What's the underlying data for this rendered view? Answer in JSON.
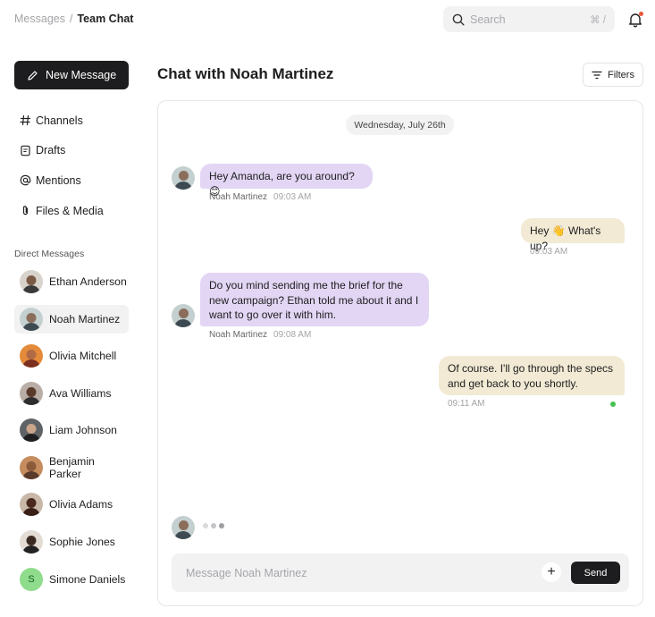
{
  "breadcrumb": {
    "parent": "Messages",
    "separator": "/",
    "current": "Team Chat"
  },
  "search": {
    "placeholder": "Search",
    "shortcut": "⌘ /",
    "icon": "search-icon"
  },
  "header": {
    "notification_icon": "bell-icon",
    "has_unread": true
  },
  "sidebar": {
    "new_message_label": "New Message",
    "nav": [
      {
        "label": "Channels",
        "icon": "hash-icon"
      },
      {
        "label": "Drafts",
        "icon": "file-icon"
      },
      {
        "label": "Mentions",
        "icon": "at-icon"
      },
      {
        "label": "Files & Media",
        "icon": "paperclip-icon"
      }
    ],
    "direct_messages_title": "Direct Messages",
    "direct_messages": [
      {
        "name": "Ethan Anderson",
        "active": false
      },
      {
        "name": "Noah Martinez",
        "active": true
      },
      {
        "name": "Olivia Mitchell",
        "active": false
      },
      {
        "name": "Ava Williams",
        "active": false
      },
      {
        "name": "Liam Johnson",
        "active": false
      },
      {
        "name": "Benjamin Parker",
        "active": false
      },
      {
        "name": "Olivia Adams",
        "active": false
      },
      {
        "name": "Sophie Jones",
        "active": false
      },
      {
        "name": "Simone Daniels",
        "active": false,
        "initial": "S"
      }
    ]
  },
  "chat": {
    "title": "Chat with Noah Martinez",
    "filters_label": "Filters",
    "date_divider": "Wednesday, July 26th",
    "messages": [
      {
        "direction": "in",
        "text": "Hey Amanda, are you around? 😊",
        "sender": "Noah Martinez",
        "time": "09:03 AM"
      },
      {
        "direction": "out",
        "text": "Hey 👋 What's up?",
        "time": "09:03 AM"
      },
      {
        "direction": "in",
        "text": "Do you mind sending me the brief for the new campaign? Ethan told me about it and I want to go over it with him.",
        "sender": "Noah Martinez",
        "time": "09:08 AM"
      },
      {
        "direction": "out",
        "text": "Of course. I'll go through the specs and get back to you shortly.",
        "time": "09:11 AM",
        "read": true
      }
    ],
    "typing_indicator": true
  },
  "composer": {
    "placeholder": "Message Noah Martinez",
    "add_label": "+",
    "send_label": "Send"
  },
  "colors": {
    "accent_dark": "#1d1d1f",
    "incoming_bubble": "#e3d6f4",
    "outgoing_bubble": "#f2ead4",
    "read_indicator": "#47c14f",
    "notification_dot": "#e8573a"
  }
}
